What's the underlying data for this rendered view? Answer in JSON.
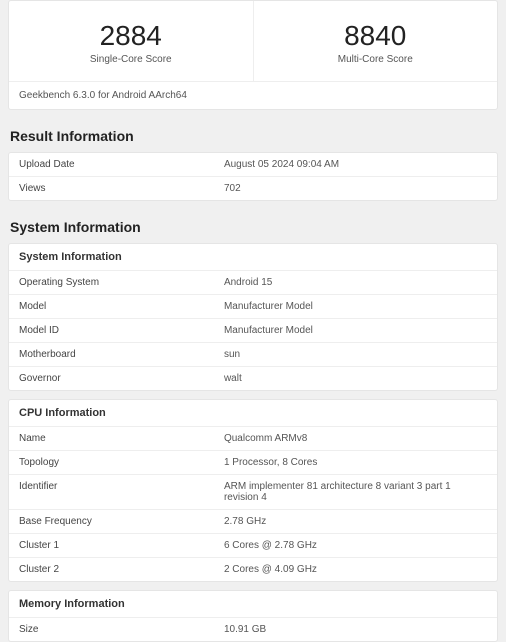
{
  "scores": {
    "singleCore": {
      "value": "2884",
      "label": "Single-Core Score"
    },
    "multiCore": {
      "value": "8840",
      "label": "Multi-Core Score"
    },
    "version": "Geekbench 6.3.0 for Android AArch64"
  },
  "resultInfo": {
    "title": "Result Information",
    "rows": [
      {
        "label": "Upload Date",
        "value": "August 05 2024 09:04 AM"
      },
      {
        "label": "Views",
        "value": "702"
      }
    ]
  },
  "systemInfo": {
    "title": "System Information",
    "panels": {
      "system": {
        "header": "System Information",
        "rows": [
          {
            "label": "Operating System",
            "value": "Android 15"
          },
          {
            "label": "Model",
            "value": "Manufacturer Model"
          },
          {
            "label": "Model ID",
            "value": "Manufacturer Model"
          },
          {
            "label": "Motherboard",
            "value": "sun"
          },
          {
            "label": "Governor",
            "value": "walt"
          }
        ]
      },
      "cpu": {
        "header": "CPU Information",
        "rows": [
          {
            "label": "Name",
            "value": "Qualcomm ARMv8"
          },
          {
            "label": "Topology",
            "value": "1 Processor, 8 Cores"
          },
          {
            "label": "Identifier",
            "value": "ARM implementer 81 architecture 8 variant 3 part 1 revision 4"
          },
          {
            "label": "Base Frequency",
            "value": "2.78 GHz"
          },
          {
            "label": "Cluster 1",
            "value": "6 Cores @ 2.78 GHz"
          },
          {
            "label": "Cluster 2",
            "value": "2 Cores @ 4.09 GHz"
          }
        ]
      },
      "memory": {
        "header": "Memory Information",
        "rows": [
          {
            "label": "Size",
            "value": "10.91 GB"
          }
        ]
      }
    }
  }
}
